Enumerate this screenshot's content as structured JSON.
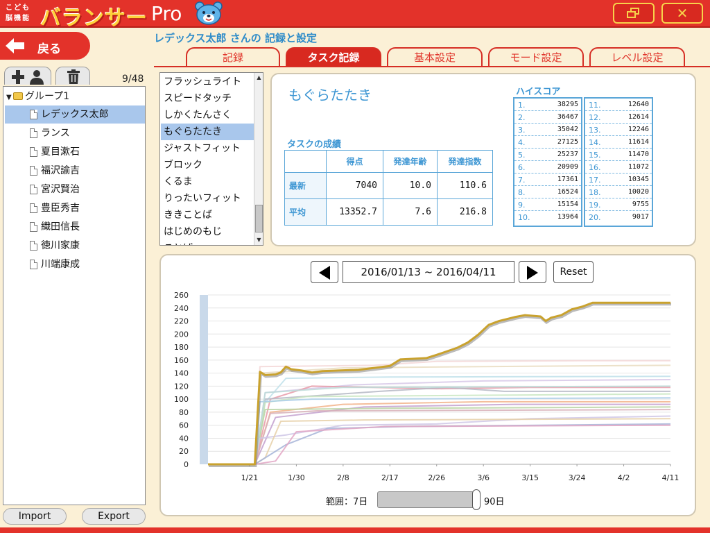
{
  "app": {
    "logo_small_line1": "こども",
    "logo_small_line2": "脳機能",
    "logo_main": "バランサー",
    "logo_pro": "Pro",
    "back_label": "戻る",
    "page_title": "レデックス太郎 さんの 記録と設定"
  },
  "tabs": [
    {
      "label": "記録",
      "active": false
    },
    {
      "label": "タスク記録",
      "active": true
    },
    {
      "label": "基本設定",
      "active": false
    },
    {
      "label": "モード設定",
      "active": false
    },
    {
      "label": "レベル設定",
      "active": false
    }
  ],
  "sidebar": {
    "count": "9/48",
    "group": "グループ1",
    "members": [
      "レデックス太郎",
      "ランス",
      "夏目漱石",
      "福沢諭吉",
      "宮沢賢治",
      "豊臣秀吉",
      "織田信長",
      "徳川家康",
      "川端康成"
    ],
    "selected_index": 0,
    "import_label": "Import",
    "export_label": "Export"
  },
  "tasks": {
    "items": [
      "フラッシュライト",
      "スピードタッチ",
      "しかくたんさく",
      "もぐらたたき",
      "ジャストフィット",
      "ブロック",
      "くるま",
      "りったいフィット",
      "ききことば",
      "はじめのもじ"
    ],
    "selected_index": 3,
    "partial_item": "ことば"
  },
  "task_info": {
    "name": "もぐらたたき",
    "results_title": "タスクの成績",
    "columns": [
      "得点",
      "発達年齢",
      "発達指数"
    ],
    "rows": [
      {
        "label": "最新",
        "values": [
          "7040",
          "10.0",
          "110.6"
        ]
      },
      {
        "label": "平均",
        "values": [
          "13352.7",
          "7.6",
          "216.8"
        ]
      }
    ],
    "highscore_title": "ハイスコア",
    "highscores": [
      {
        "rank": "1.",
        "score": "38295"
      },
      {
        "rank": "2.",
        "score": "36467"
      },
      {
        "rank": "3.",
        "score": "35042"
      },
      {
        "rank": "4.",
        "score": "27125"
      },
      {
        "rank": "5.",
        "score": "25237"
      },
      {
        "rank": "6.",
        "score": "20909"
      },
      {
        "rank": "7.",
        "score": "17361"
      },
      {
        "rank": "8.",
        "score": "16524"
      },
      {
        "rank": "9.",
        "score": "15154"
      },
      {
        "rank": "10.",
        "score": "13964"
      },
      {
        "rank": "11.",
        "score": "12640"
      },
      {
        "rank": "12.",
        "score": "12614"
      },
      {
        "rank": "13.",
        "score": "12246"
      },
      {
        "rank": "14.",
        "score": "11614"
      },
      {
        "rank": "15.",
        "score": "11470"
      },
      {
        "rank": "16.",
        "score": "11072"
      },
      {
        "rank": "17.",
        "score": "10345"
      },
      {
        "rank": "18.",
        "score": "10020"
      },
      {
        "rank": "19.",
        "score": "9755"
      },
      {
        "rank": "20.",
        "score": "9017"
      }
    ]
  },
  "chart_controls": {
    "date_range": "2016/01/13 ~ 2016/04/11",
    "reset_label": "Reset",
    "range_label": "範囲：7日",
    "range_max": "90日",
    "range_fraction": 1.0
  },
  "chart_data": {
    "type": "line",
    "title": "",
    "xlabel": "",
    "ylabel": "",
    "ylim": [
      0,
      260
    ],
    "yticks": [
      0,
      20,
      40,
      60,
      80,
      100,
      120,
      140,
      160,
      180,
      200,
      220,
      240,
      260
    ],
    "xlim": [
      "2016-01-13",
      "2016-04-11"
    ],
    "xticks": [
      {
        "label": "1/21",
        "date": "2016-01-21"
      },
      {
        "label": "1/30",
        "date": "2016-01-30"
      },
      {
        "label": "2/8",
        "date": "2016-02-08"
      },
      {
        "label": "2/17",
        "date": "2016-02-17"
      },
      {
        "label": "2/26",
        "date": "2016-02-26"
      },
      {
        "label": "3/6",
        "date": "2016-03-06"
      },
      {
        "label": "3/15",
        "date": "2016-03-15"
      },
      {
        "label": "3/24",
        "date": "2016-03-24"
      },
      {
        "label": "4/2",
        "date": "2016-04-02"
      },
      {
        "label": "4/11",
        "date": "2016-04-11"
      }
    ],
    "grid": true,
    "highlight_color": "#c9a22e",
    "series": [
      {
        "highlight": true,
        "points": [
          [
            "2016-01-13",
            0
          ],
          [
            "2016-01-22",
            0
          ],
          [
            "2016-01-23",
            142
          ],
          [
            "2016-01-24",
            137
          ],
          [
            "2016-01-26",
            138
          ],
          [
            "2016-01-27",
            141
          ],
          [
            "2016-01-28",
            150
          ],
          [
            "2016-01-29",
            146
          ],
          [
            "2016-01-31",
            144
          ],
          [
            "2016-02-02",
            141
          ],
          [
            "2016-02-04",
            143
          ],
          [
            "2016-02-07",
            144
          ],
          [
            "2016-02-11",
            145
          ],
          [
            "2016-02-14",
            148
          ],
          [
            "2016-02-17",
            151
          ],
          [
            "2016-02-19",
            161
          ],
          [
            "2016-02-24",
            163
          ],
          [
            "2016-02-26",
            168
          ],
          [
            "2016-03-01",
            179
          ],
          [
            "2016-03-03",
            187
          ],
          [
            "2016-03-05",
            199
          ],
          [
            "2016-03-07",
            214
          ],
          [
            "2016-03-09",
            220
          ],
          [
            "2016-03-12",
            226
          ],
          [
            "2016-03-14",
            229
          ],
          [
            "2016-03-17",
            227
          ],
          [
            "2016-03-18",
            220
          ],
          [
            "2016-03-19",
            225
          ],
          [
            "2016-03-21",
            229
          ],
          [
            "2016-03-23",
            238
          ],
          [
            "2016-03-25",
            242
          ],
          [
            "2016-03-27",
            248
          ],
          [
            "2016-04-11",
            248
          ]
        ]
      },
      {
        "color": "#f3d7d7",
        "points": [
          [
            "2016-01-13",
            0
          ],
          [
            "2016-01-22",
            0
          ],
          [
            "2016-01-23",
            150
          ],
          [
            "2016-02-14",
            152
          ],
          [
            "2016-02-26",
            158
          ],
          [
            "2016-03-24",
            159
          ],
          [
            "2016-04-11",
            159
          ]
        ]
      },
      {
        "color": "#e9dcc0",
        "points": [
          [
            "2016-01-13",
            0
          ],
          [
            "2016-01-22",
            0
          ],
          [
            "2016-01-23",
            140
          ],
          [
            "2016-02-08",
            148
          ],
          [
            "2016-03-06",
            150
          ],
          [
            "2016-04-11",
            152
          ]
        ]
      },
      {
        "color": "#bfe0ea",
        "points": [
          [
            "2016-01-13",
            0
          ],
          [
            "2016-01-22",
            0
          ],
          [
            "2016-01-24",
            95
          ],
          [
            "2016-01-28",
            132
          ],
          [
            "2016-02-17",
            134
          ],
          [
            "2016-04-11",
            135
          ]
        ]
      },
      {
        "color": "#d7c8e8",
        "points": [
          [
            "2016-01-13",
            0
          ],
          [
            "2016-01-22",
            0
          ],
          [
            "2016-01-24",
            110
          ],
          [
            "2016-02-10",
            122
          ],
          [
            "2016-03-06",
            128
          ],
          [
            "2016-04-11",
            130
          ]
        ]
      },
      {
        "color": "#e89aa8",
        "points": [
          [
            "2016-01-13",
            0
          ],
          [
            "2016-01-22",
            0
          ],
          [
            "2016-01-25",
            100
          ],
          [
            "2016-02-02",
            120
          ],
          [
            "2016-02-26",
            116
          ],
          [
            "2016-03-15",
            118
          ],
          [
            "2016-04-11",
            118
          ]
        ]
      },
      {
        "color": "#b5b8c4",
        "points": [
          [
            "2016-01-13",
            0
          ],
          [
            "2016-01-22",
            0
          ],
          [
            "2016-01-24",
            100
          ],
          [
            "2016-02-15",
            112
          ],
          [
            "2016-02-28",
            118
          ],
          [
            "2016-03-10",
            112
          ],
          [
            "2016-04-11",
            112
          ]
        ]
      },
      {
        "color": "#c9e6c1",
        "points": [
          [
            "2016-01-13",
            0
          ],
          [
            "2016-01-22",
            0
          ],
          [
            "2016-01-24",
            95
          ],
          [
            "2016-02-01",
            104
          ],
          [
            "2016-03-06",
            106
          ],
          [
            "2016-04-11",
            108
          ]
        ]
      },
      {
        "color": "#a9cde8",
        "points": [
          [
            "2016-01-13",
            0
          ],
          [
            "2016-01-22",
            0
          ],
          [
            "2016-01-23",
            96
          ],
          [
            "2016-02-02",
            100
          ],
          [
            "2016-04-11",
            102
          ]
        ]
      },
      {
        "color": "#f2b38a",
        "points": [
          [
            "2016-01-13",
            0
          ],
          [
            "2016-01-22",
            0
          ],
          [
            "2016-01-25",
            80
          ],
          [
            "2016-02-08",
            92
          ],
          [
            "2016-03-06",
            96
          ],
          [
            "2016-04-11",
            96
          ]
        ]
      },
      {
        "color": "#c3a0cf",
        "points": [
          [
            "2016-01-13",
            0
          ],
          [
            "2016-01-22",
            0
          ],
          [
            "2016-01-26",
            72
          ],
          [
            "2016-02-12",
            88
          ],
          [
            "2016-03-12",
            92
          ],
          [
            "2016-04-11",
            92
          ]
        ]
      },
      {
        "color": "#b8d4a3",
        "points": [
          [
            "2016-01-13",
            0
          ],
          [
            "2016-01-22",
            0
          ],
          [
            "2016-01-24",
            84
          ],
          [
            "2016-02-17",
            86
          ],
          [
            "2016-04-11",
            88
          ]
        ]
      },
      {
        "color": "#d8b0b8",
        "points": [
          [
            "2016-01-13",
            0
          ],
          [
            "2016-01-22",
            0
          ],
          [
            "2016-01-25",
            78
          ],
          [
            "2016-02-03",
            82
          ],
          [
            "2016-04-11",
            84
          ]
        ]
      },
      {
        "color": "#cfc7e6",
        "points": [
          [
            "2016-01-13",
            0
          ],
          [
            "2016-01-22",
            0
          ],
          [
            "2016-01-23",
            40
          ],
          [
            "2016-01-28",
            45
          ],
          [
            "2016-02-08",
            60
          ],
          [
            "2016-02-26",
            62
          ],
          [
            "2016-03-15",
            70
          ],
          [
            "2016-04-11",
            74
          ]
        ]
      },
      {
        "color": "#e6d0a8",
        "points": [
          [
            "2016-01-13",
            0
          ],
          [
            "2016-01-22",
            0
          ],
          [
            "2016-01-24",
            10
          ],
          [
            "2016-01-27",
            66
          ],
          [
            "2016-02-12",
            68
          ],
          [
            "2016-04-11",
            70
          ]
        ]
      },
      {
        "color": "#a6b4d8",
        "points": [
          [
            "2016-01-13",
            0
          ],
          [
            "2016-01-22",
            0
          ],
          [
            "2016-01-28",
            30
          ],
          [
            "2016-02-05",
            55
          ],
          [
            "2016-02-20",
            58
          ],
          [
            "2016-04-11",
            62
          ]
        ]
      },
      {
        "color": "#e2a6c4",
        "points": [
          [
            "2016-01-13",
            0
          ],
          [
            "2016-01-22",
            0
          ],
          [
            "2016-01-26",
            5
          ],
          [
            "2016-01-30",
            50
          ],
          [
            "2016-02-16",
            58
          ],
          [
            "2016-04-11",
            60
          ]
        ]
      },
      {
        "color": "#bcdcd8",
        "points": [
          [
            "2016-01-13",
            0
          ],
          [
            "2016-01-22",
            0
          ],
          [
            "2016-01-24",
            110
          ],
          [
            "2016-02-08",
            118
          ],
          [
            "2016-04-11",
            120
          ]
        ]
      }
    ]
  }
}
